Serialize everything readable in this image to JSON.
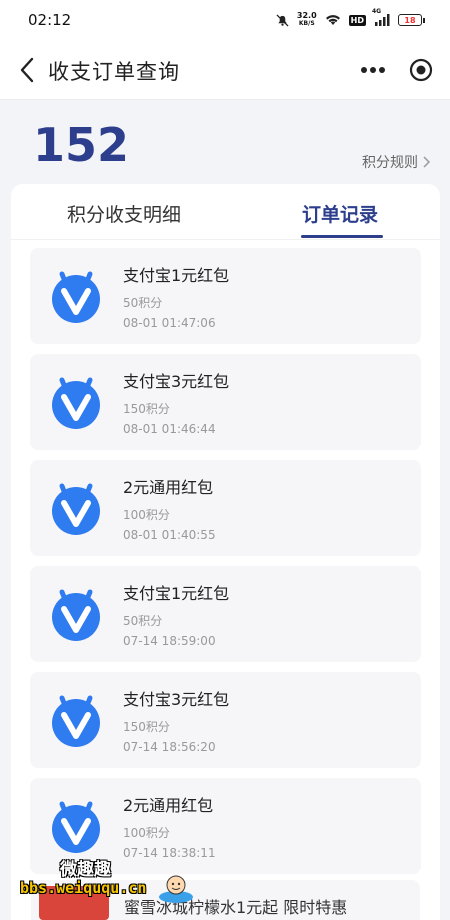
{
  "status_bar": {
    "time": "02:12",
    "net_speed_value": "32.0",
    "net_speed_unit": "KB/S",
    "hd_label": "HD",
    "signal_label": "4G",
    "battery_level": "18",
    "icons": [
      "mute-icon",
      "wifi-icon",
      "signal-icon",
      "battery-icon"
    ]
  },
  "nav": {
    "title": "收支订单查询",
    "icons": [
      "back-arrow-icon",
      "more-dots-icon",
      "target-icon"
    ]
  },
  "points": {
    "value": "152",
    "rules_label": "积分规则"
  },
  "tabs": [
    {
      "label": "积分收支明细",
      "active": false
    },
    {
      "label": "订单记录",
      "active": true
    }
  ],
  "orders": [
    {
      "title": "支付宝1元红包",
      "points": "50积分",
      "time": "08-01 01:47:06"
    },
    {
      "title": "支付宝3元红包",
      "points": "150积分",
      "time": "08-01 01:46:44"
    },
    {
      "title": "2元通用红包",
      "points": "100积分",
      "time": "08-01 01:40:55"
    },
    {
      "title": "支付宝1元红包",
      "points": "50积分",
      "time": "07-14 18:59:00"
    },
    {
      "title": "支付宝3元红包",
      "points": "150积分",
      "time": "07-14 18:56:20"
    },
    {
      "title": "2元通用红包",
      "points": "100积分",
      "time": "07-14 18:38:11"
    }
  ],
  "banner": {
    "text": "蜜雪冰城柠檬水1元起 限时特惠"
  },
  "watermark": {
    "line1": "微趣趣",
    "line2": "bbs.weiququ.cn"
  },
  "colors": {
    "accent": "#2c3e8c",
    "logo_blue": "#2f7bf0",
    "background": "#f3f4f8"
  }
}
